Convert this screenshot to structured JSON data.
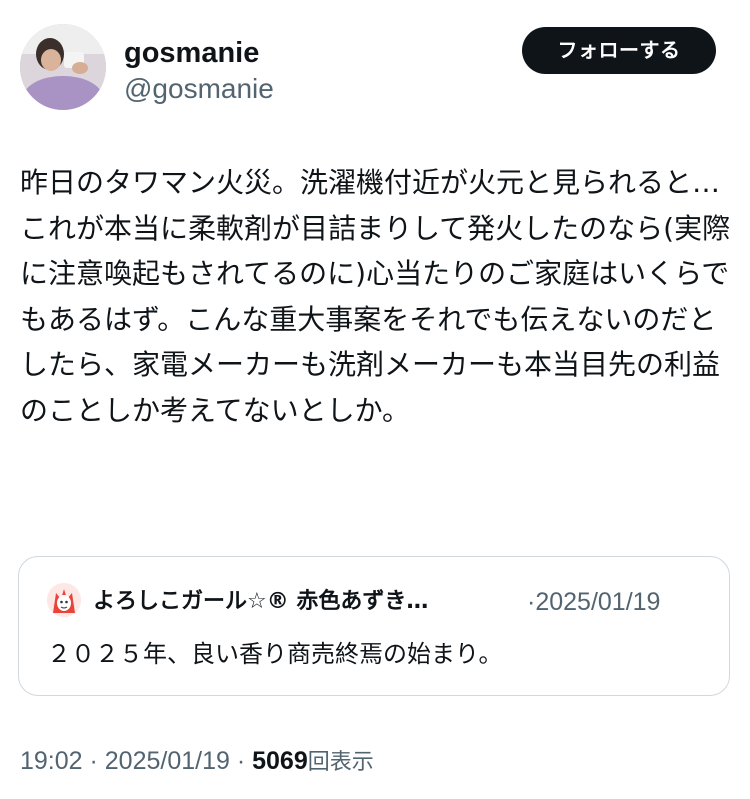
{
  "author": {
    "display_name": "gosmanie",
    "handle": "@gosmanie",
    "avatar_icon": "profile-photo-icon"
  },
  "follow_button": {
    "label": "フォローする"
  },
  "tweet": {
    "text": "昨日のタワマン火災。洗濯機付近が火元と見られると…これが本当に柔軟剤が目詰まりして発火したのなら(実際に注意喚起もされてるのに)心当たりのご家庭はいくらでもあるはず。こんな重大事案をそれでも伝えないのだとしたら、家電メーカーも洗剤メーカーも本当目先の利益のことしか考えてないとしか。"
  },
  "quote": {
    "author_name": "よろしこガール☆® 赤色あずき…",
    "separator": "·",
    "date": "2025/01/19",
    "text": "２０２５年、良い香り商売終焉の始まり。",
    "avatar_icon": "anime-girl-avatar-icon"
  },
  "meta": {
    "time": "19:02",
    "separator_1": " · ",
    "date": "2025/01/19",
    "separator_2": " · ",
    "views_count": "5069",
    "views_label": "回表示"
  },
  "colors": {
    "text_primary": "#0f1419",
    "text_secondary": "#536471",
    "border": "#cfd9de",
    "button_bg": "#0f1419",
    "button_text": "#ffffff"
  }
}
